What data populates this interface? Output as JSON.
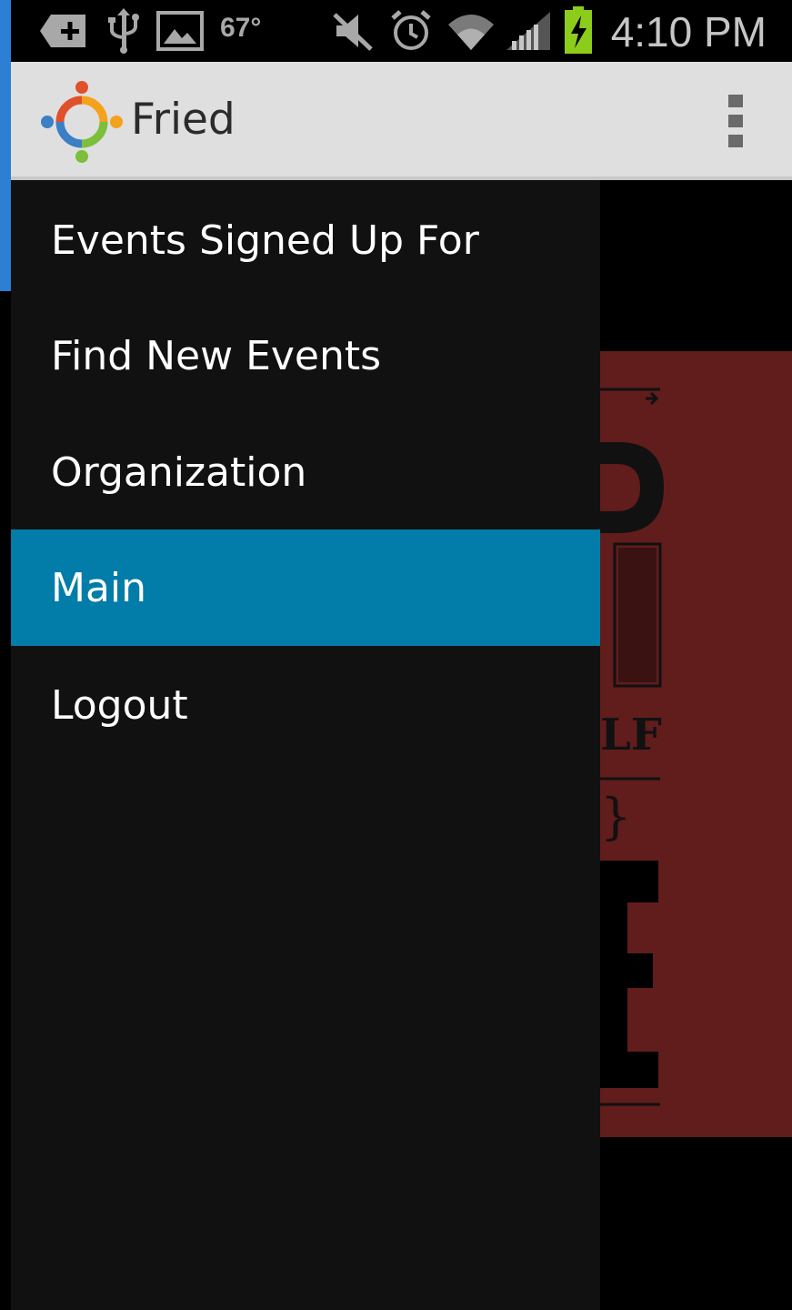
{
  "status_bar": {
    "temperature": "67°",
    "time": "4:10 PM",
    "icons": [
      "notification-plus-icon",
      "usb-icon",
      "image-icon",
      "mute-icon",
      "alarm-icon",
      "wifi-icon",
      "signal-icon",
      "battery-charging-icon"
    ]
  },
  "action_bar": {
    "title": "Fried",
    "logo_icon": "people-circle-logo-icon",
    "overflow_icon": "overflow-menu-icon"
  },
  "drawer": {
    "items": [
      {
        "label": "Events Signed Up For",
        "selected": false
      },
      {
        "label": "Find New Events",
        "selected": false
      },
      {
        "label": "Organization",
        "selected": false
      },
      {
        "label": "Main",
        "selected": true
      },
      {
        "label": "Logout",
        "selected": false
      }
    ]
  },
  "colors": {
    "action_bar_bg": "#dfdfdf",
    "drawer_bg": "#111111",
    "selected_item_bg": "#027ca8",
    "poster_red": "#611c1c"
  }
}
